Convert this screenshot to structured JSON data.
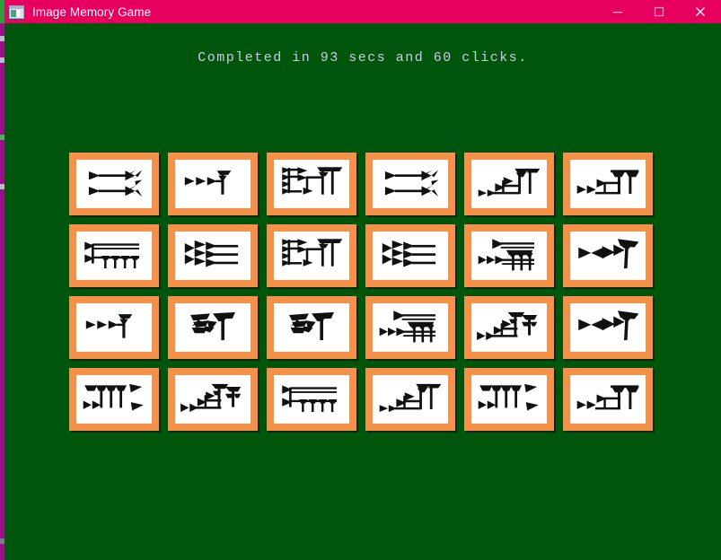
{
  "window": {
    "title": "Image Memory Game",
    "app_icon": "image-window-icon",
    "titlebar_color": "#e8005e",
    "background_color": "#00550c",
    "controls": [
      {
        "name": "minimize",
        "glyph": "minimize-icon"
      },
      {
        "name": "maximize",
        "glyph": "maximize-icon"
      },
      {
        "name": "close",
        "glyph": "close-icon"
      }
    ]
  },
  "status": {
    "text": "Completed in 93 secs and 60 clicks.",
    "seconds": 93,
    "clicks": 60,
    "color": "#ccccdd"
  },
  "board": {
    "rows": 4,
    "columns": 6,
    "total_cards": 24,
    "card_border_color": "#f79049",
    "card_face_color": "#ffffff",
    "glyph_color": "#111111",
    "all_revealed": true,
    "cards": [
      {
        "position": "r1c1",
        "glyph": "cuneiform-double-bar",
        "pair_id": 1,
        "revealed": true
      },
      {
        "position": "r1c2",
        "glyph": "cuneiform-three-wedge-tee",
        "pair_id": 2,
        "revealed": true
      },
      {
        "position": "r1c3",
        "glyph": "cuneiform-ladder-twin-post",
        "pair_id": 3,
        "revealed": true
      },
      {
        "position": "r1c4",
        "glyph": "cuneiform-double-bar",
        "pair_id": 1,
        "revealed": true
      },
      {
        "position": "r1c5",
        "glyph": "cuneiform-stair-twin-post",
        "pair_id": 4,
        "revealed": true
      },
      {
        "position": "r1c6",
        "glyph": "cuneiform-arrow-canopy-post",
        "pair_id": 5,
        "revealed": true
      },
      {
        "position": "r2c1",
        "glyph": "cuneiform-comb-bar",
        "pair_id": 6,
        "revealed": true
      },
      {
        "position": "r2c2",
        "glyph": "cuneiform-triple-line-fan",
        "pair_id": 7,
        "revealed": true
      },
      {
        "position": "r2c3",
        "glyph": "cuneiform-ladder-twin-post",
        "pair_id": 3,
        "revealed": true
      },
      {
        "position": "r2c4",
        "glyph": "cuneiform-triple-line-fan",
        "pair_id": 7,
        "revealed": true
      },
      {
        "position": "r2c5",
        "glyph": "cuneiform-brush-rake",
        "pair_id": 8,
        "revealed": true
      },
      {
        "position": "r2c6",
        "glyph": "cuneiform-bowtie-mast",
        "pair_id": 9,
        "revealed": true
      },
      {
        "position": "r3c1",
        "glyph": "cuneiform-three-wedge-tee",
        "pair_id": 2,
        "revealed": true
      },
      {
        "position": "r3c2",
        "glyph": "cuneiform-knot-flag",
        "pair_id": 10,
        "revealed": true
      },
      {
        "position": "r3c3",
        "glyph": "cuneiform-knot-flag",
        "pair_id": 10,
        "revealed": true
      },
      {
        "position": "r3c4",
        "glyph": "cuneiform-brush-rake",
        "pair_id": 8,
        "revealed": true
      },
      {
        "position": "r3c5",
        "glyph": "cuneiform-stack-twin-crown",
        "pair_id": 11,
        "revealed": true
      },
      {
        "position": "r3c6",
        "glyph": "cuneiform-bowtie-mast",
        "pair_id": 9,
        "revealed": true
      },
      {
        "position": "r4c1",
        "glyph": "cuneiform-picket-pair",
        "pair_id": 12,
        "revealed": true
      },
      {
        "position": "r4c2",
        "glyph": "cuneiform-stack-twin-crown",
        "pair_id": 11,
        "revealed": true
      },
      {
        "position": "r4c3",
        "glyph": "cuneiform-comb-bar",
        "pair_id": 6,
        "revealed": true
      },
      {
        "position": "r4c4",
        "glyph": "cuneiform-stair-twin-post",
        "pair_id": 4,
        "revealed": true
      },
      {
        "position": "r4c5",
        "glyph": "cuneiform-picket-pair",
        "pair_id": 12,
        "revealed": true
      },
      {
        "position": "r4c6",
        "glyph": "cuneiform-arrow-canopy-post",
        "pair_id": 5,
        "revealed": true
      }
    ]
  }
}
